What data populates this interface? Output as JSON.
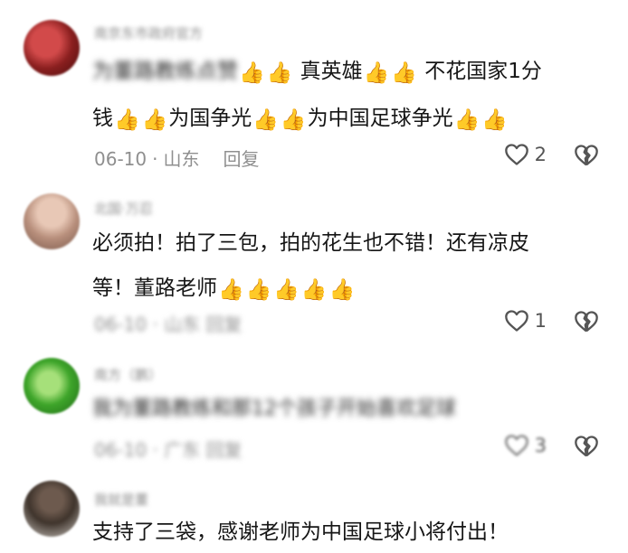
{
  "comments": [
    {
      "username": "南京东市政府官方",
      "text_blurred": "为董路教练点赞",
      "text_line1": "真英雄",
      "text_line1b": "不花国家1分",
      "text_line2a": "钱",
      "text_line2b": "为国争光",
      "text_line2c": "为中国足球争光",
      "date": "06-10",
      "location": "山东",
      "reply": "回复",
      "likes": "2"
    },
    {
      "username": "北国·万忍",
      "text_line1": "必须拍！拍了三包，拍的花生也不错！还有凉皮",
      "text_line2": "等！董路老师",
      "meta_blurred": "06-10 · 山东  回复",
      "likes": "1"
    },
    {
      "username": "南方（鹏）",
      "text_blurred": "我为董路教练和那12个孩子开始喜欢足球",
      "meta_blurred": "06-10 · 广东  回复",
      "likes": "3"
    },
    {
      "username": "我就是董",
      "text": "支持了三袋，感谢老师为中国足球小将付出！"
    }
  ],
  "icons": {
    "thumb": "thumbs-up-emoji",
    "like": "heart-outline-icon",
    "dislike": "broken-heart-icon"
  }
}
